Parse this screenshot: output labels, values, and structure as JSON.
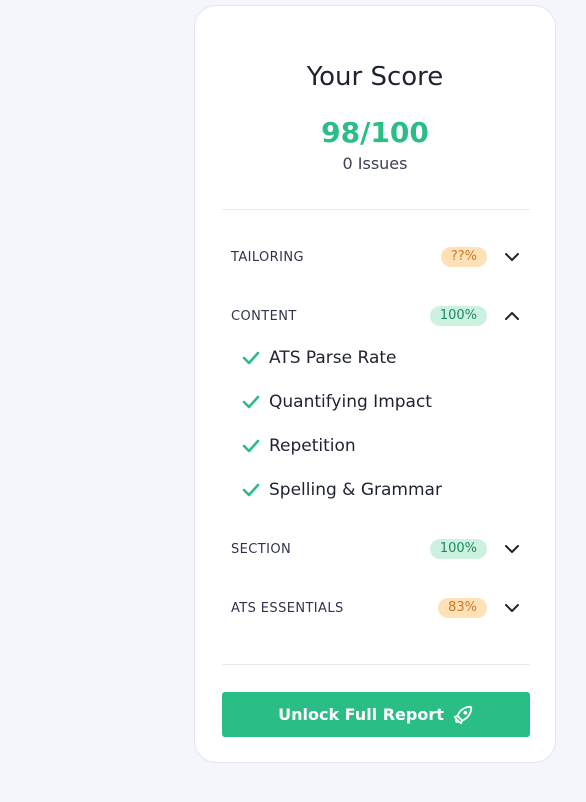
{
  "score_card": {
    "title": "Your Score",
    "score": "98/100",
    "issues": "0 Issues"
  },
  "categories": [
    {
      "label": "TAILORING",
      "badge": "??%",
      "status": "warning",
      "expanded": false,
      "chevron": "chevron-down-icon"
    },
    {
      "label": "CONTENT",
      "badge": "100%",
      "status": "good",
      "expanded": true,
      "chevron": "chevron-up-icon"
    },
    {
      "label": "SECTION",
      "badge": "100%",
      "status": "good",
      "expanded": false,
      "chevron": "chevron-down-icon"
    },
    {
      "label": "ATS ESSENTIALS",
      "badge": "83%",
      "status": "warning",
      "expanded": false,
      "chevron": "chevron-down-icon"
    }
  ],
  "content_items": [
    {
      "label": "ATS Parse Rate",
      "icon": "check-icon"
    },
    {
      "label": "Quantifying Impact",
      "icon": "check-icon"
    },
    {
      "label": "Repetition",
      "icon": "check-icon"
    },
    {
      "label": "Spelling & Grammar",
      "icon": "check-icon"
    }
  ],
  "unlock_button": {
    "label": "Unlock Full Report",
    "icon": "rocket-icon"
  },
  "colors": {
    "accent": "#2bbd86",
    "warning_bg": "#ffe1b8",
    "warning_text": "#c97a2b",
    "good_bg": "#cdf1e1",
    "good_text": "#1e8a5f",
    "background": "#f5f6fb"
  }
}
